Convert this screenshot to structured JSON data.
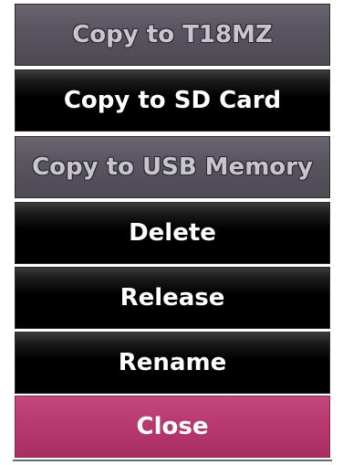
{
  "menu": {
    "items": [
      {
        "label": "Copy to T18MZ",
        "enabled": false
      },
      {
        "label": "Copy to SD Card",
        "enabled": true
      },
      {
        "label": "Copy to USB Memory",
        "enabled": false
      },
      {
        "label": "Delete",
        "enabled": true
      },
      {
        "label": "Release",
        "enabled": true
      },
      {
        "label": "Rename",
        "enabled": true
      }
    ],
    "close_label": "Close"
  },
  "colors": {
    "button_dark": "#000000",
    "button_disabled": "#5a5560",
    "button_close": "#b93a70",
    "text_enabled": "#ffffff",
    "text_disabled": "#c6c6cc"
  }
}
